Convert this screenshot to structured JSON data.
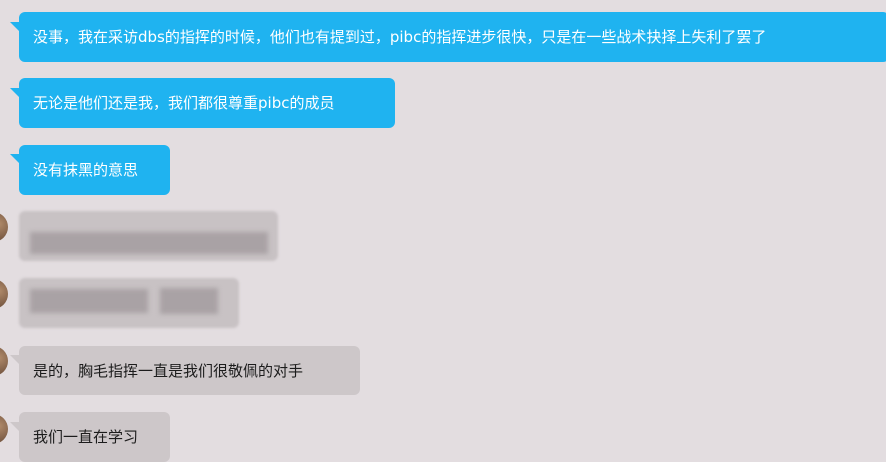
{
  "messages": [
    {
      "text": "没事，我在采访dbs的指挥的时候，他们也有提到过，pibc的指挥进步很快，只是在一些战术抉择上失利了罢了"
    },
    {
      "text": "无论是他们还是我，我们都很尊重pibc的成员"
    },
    {
      "text": "没有抹黑的意思"
    },
    {
      "text": "是的，胸毛指挥一直是我们很敬佩的对手"
    },
    {
      "text": "我们一直在学习"
    }
  ]
}
